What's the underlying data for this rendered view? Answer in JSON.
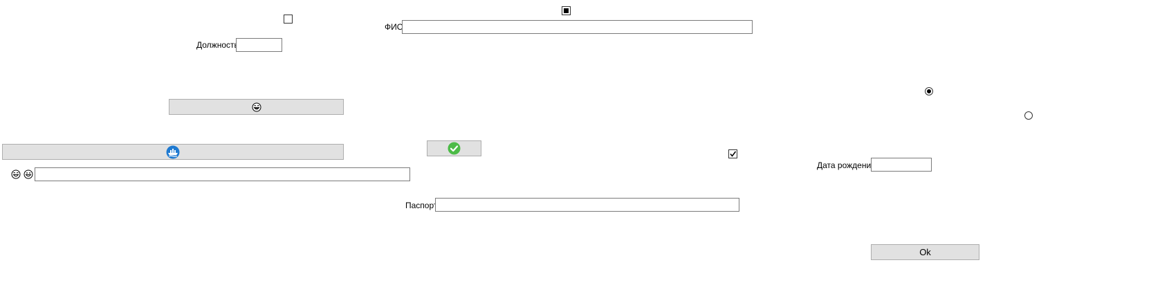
{
  "form": {
    "fio_label": "ФИО",
    "fio_value": "",
    "position_label": "Должность",
    "position_value": "",
    "birthdate_label": "Дата рождения",
    "birthdate_value": "",
    "passport_label": "Паспорт",
    "passport_value": "",
    "emoji_field_value": ""
  },
  "buttons": {
    "ok_label": "Ok",
    "emoji_button_icon": "grinning-face-icon",
    "steam_button_icon": "blue-circle-ship-icon",
    "check_button_icon": "green-check-circle-icon"
  },
  "checkboxes": {
    "top_left_checked": false,
    "top_center_state": "indeterminate",
    "right_checked": true
  },
  "radios": {
    "first_selected": true,
    "second_selected": false
  },
  "icons": {
    "emoji_prefix_1": "grinning-face-icon",
    "emoji_prefix_2": "grinning-face-icon"
  },
  "colors": {
    "button_bg": "#e1e1e1",
    "button_border": "#adadad",
    "field_border": "#7a7a7a",
    "check_green": "#4cbb47",
    "icon_blue": "#1f7ad1"
  }
}
